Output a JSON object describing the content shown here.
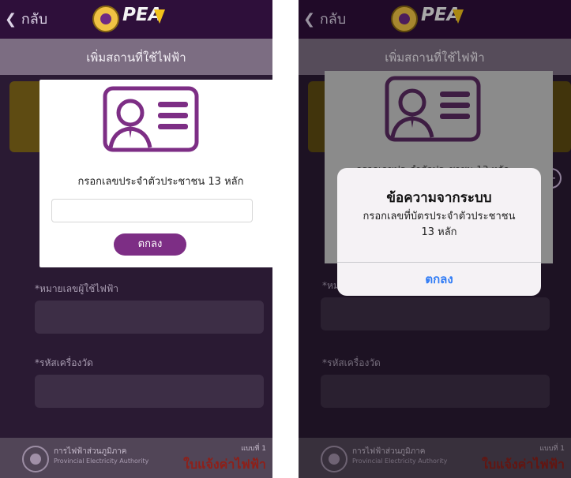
{
  "left": {
    "back_label": "กลับ",
    "brand": "PEA",
    "header_title": "เพิ่มสถานที่ใช้ไฟฟ้า",
    "fields": [
      {
        "label": "*หมายเลขผู้ใช้ไฟฟ้า",
        "value": ""
      },
      {
        "label": "*รหัสเครื่องวัด",
        "value": ""
      }
    ],
    "modal": {
      "instruction": "กรอกเลขประจำตัวประชาชน 13 หลัก",
      "input_value": "",
      "ok_label": "ตกลง"
    },
    "footer": {
      "org_th": "การไฟฟ้าส่วนภูมิภาค",
      "org_en": "Provincial Electricity Authority",
      "bill_title": "ใบแจ้งค่าไฟฟ้า",
      "form_no": "แบบที่ 1"
    }
  },
  "right": {
    "back_label": "กลับ",
    "header_title": "เพิ่มสถานที่ใช้ไฟฟ้า",
    "fields": [
      {
        "label": "*หม",
        "value": ""
      },
      {
        "label": "*รหัสเครื่องวัด",
        "value": ""
      }
    ],
    "background_modal_text": "กรอกเลขประจำตัวประชาชน 13 หลัก",
    "alert": {
      "title": "ข้อความจากระบบ",
      "message_line1": "กรอกเลขที่บัตรประจำตัวประชาชน",
      "message_line2": "13 หลัก",
      "button_label": "ตกลง"
    },
    "footer": {
      "org_th": "การไฟฟ้าส่วนภูมิภาค",
      "org_en": "Provincial Electricity Authority",
      "bill_title": "ใบแจ้งค่าไฟฟ้า",
      "form_no": "แบบที่ 1"
    }
  },
  "colors": {
    "accent_purple": "#7d2e85",
    "ios_link_blue": "#2f7bf5",
    "bill_red": "#8f1f18"
  },
  "icons": [
    "chevron-left-icon",
    "id-card-icon",
    "plus-icon",
    "pea-seal-icon"
  ]
}
